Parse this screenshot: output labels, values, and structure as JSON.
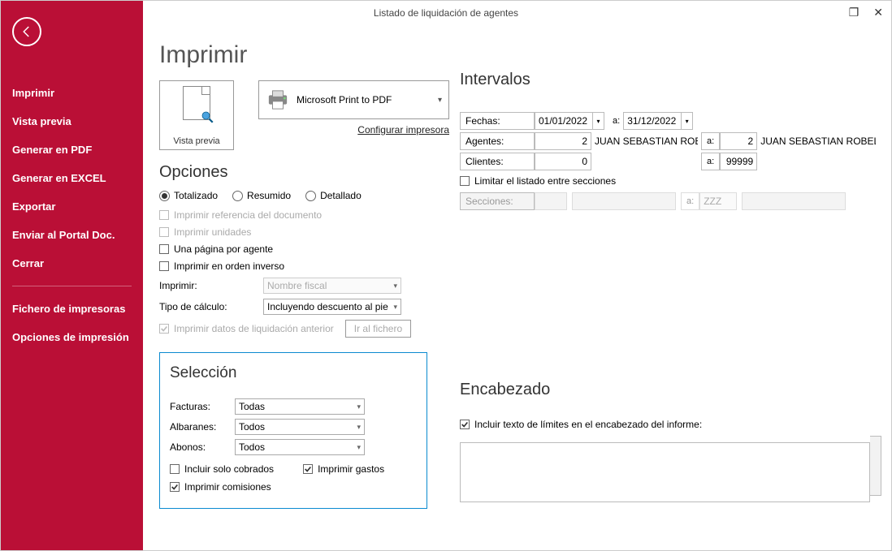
{
  "window": {
    "title": "Listado de liquidación de agentes",
    "close": "✕",
    "maximize": "❐"
  },
  "sidebar": {
    "items": [
      "Imprimir",
      "Vista previa",
      "Generar en PDF",
      "Generar en EXCEL",
      "Exportar",
      "Enviar al Portal Doc.",
      "Cerrar"
    ],
    "items2": [
      "Fichero de impresoras",
      "Opciones de impresión"
    ]
  },
  "main": {
    "title": "Imprimir",
    "preview_label": "Vista previa",
    "printer_name": "Microsoft Print to PDF",
    "configure_link": "Configurar impresora"
  },
  "options": {
    "heading": "Opciones",
    "r_total": "Totalizado",
    "r_resum": "Resumido",
    "r_detal": "Detallado",
    "c_ref": "Imprimir referencia del documento",
    "c_unid": "Imprimir unidades",
    "c_pagina": "Una página por agente",
    "c_inverso": "Imprimir en orden inverso",
    "l_imprimir": "Imprimir:",
    "v_imprimir": "Nombre fiscal",
    "l_tipo": "Tipo de cálculo:",
    "v_tipo": "Incluyendo descuento al pie",
    "c_datos_ant": "Imprimir datos de liquidación anterior",
    "btn_fichero": "Ir al fichero"
  },
  "seleccion": {
    "heading": "Selección",
    "l_facturas": "Facturas:",
    "v_facturas": "Todas",
    "l_albaranes": "Albaranes:",
    "v_albaranes": "Todos",
    "l_abonos": "Abonos:",
    "v_abonos": "Todos",
    "c_cobrados": "Incluir solo cobrados",
    "c_gastos": "Imprimir gastos",
    "c_comisiones": "Imprimir comisiones"
  },
  "intervalos": {
    "heading": "Intervalos",
    "l_fechas": "Fechas:",
    "fecha_from": "01/01/2022",
    "fecha_to": "31/12/2022",
    "a": "a:",
    "l_agentes": "Agentes:",
    "ag_from": "2",
    "ag_from_name": "JUAN SEBASTIAN ROBELO",
    "ag_to": "2",
    "ag_to_name": "JUAN SEBASTIAN ROBELO",
    "l_clientes": "Clientes:",
    "cl_from": "0",
    "cl_to": "99999",
    "c_limitar": "Limitar el listado entre secciones",
    "l_secciones": "Secciones:",
    "sec_to_hint": "ZZZ"
  },
  "encabezado": {
    "heading": "Encabezado",
    "c_incluir": "Incluir texto de límites en el encabezado del informe:"
  }
}
